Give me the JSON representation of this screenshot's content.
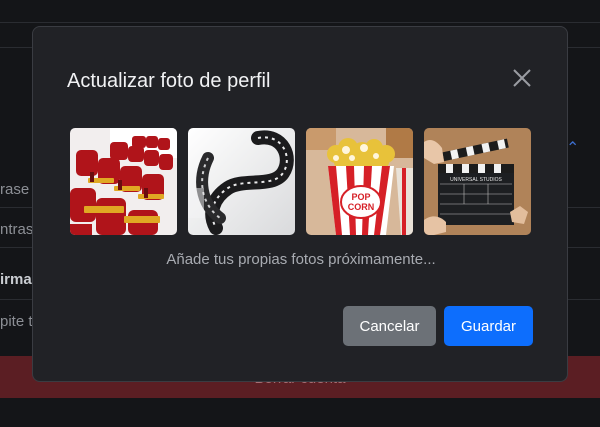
{
  "background": {
    "rows": [
      {
        "text": "rase",
        "bold": false
      },
      {
        "text": "ntras",
        "bold": false
      },
      {
        "text": "irma",
        "bold": true
      },
      {
        "text": "pite t",
        "bold": false
      }
    ],
    "danger_label": "Borrar cuenta"
  },
  "modal": {
    "title": "Actualizar foto de perfil",
    "close_icon": "close-icon",
    "photos": [
      {
        "name": "theater-seats-photo"
      },
      {
        "name": "film-reel-photo"
      },
      {
        "name": "popcorn-photo"
      },
      {
        "name": "clapperboard-photo"
      }
    ],
    "hint": "Añade tus propias fotos próximamente...",
    "buttons": {
      "cancel": "Cancelar",
      "save": "Guardar"
    }
  },
  "colors": {
    "modal_bg": "#212226",
    "primary": "#0d6efd",
    "secondary": "#6c7177"
  }
}
